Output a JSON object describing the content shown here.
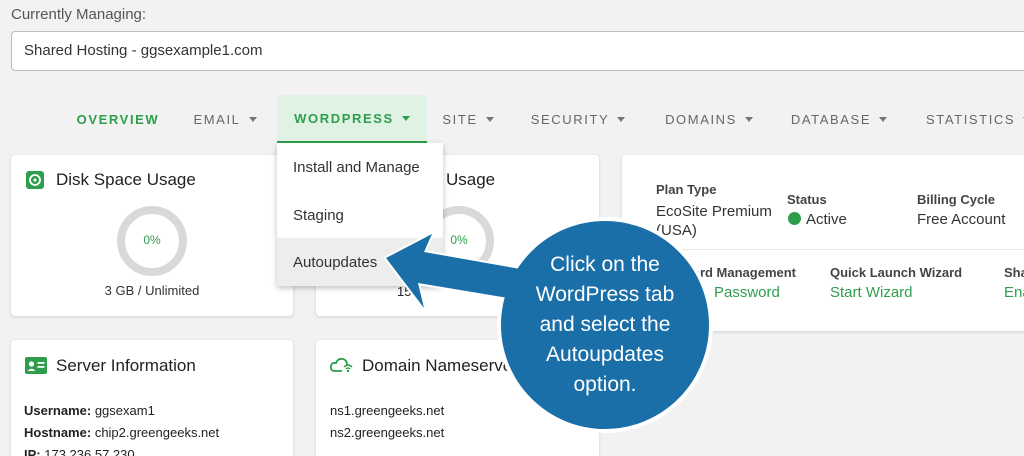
{
  "header": {
    "managing_label": "Currently Managing:",
    "selected_account": "Shared Hosting - ggsexample1.com"
  },
  "nav": {
    "tabs": [
      {
        "label": "OVERVIEW",
        "has_caret": false
      },
      {
        "label": "EMAIL",
        "has_caret": true
      },
      {
        "label": "WORDPRESS",
        "has_caret": true,
        "active": true
      },
      {
        "label": "SITE",
        "has_caret": true
      },
      {
        "label": "SECURITY",
        "has_caret": true
      },
      {
        "label": "DOMAINS",
        "has_caret": true
      },
      {
        "label": "DATABASE",
        "has_caret": true
      },
      {
        "label": "STATISTICS",
        "has_caret": true
      }
    ]
  },
  "wordpress_menu": {
    "items": [
      "Install and Manage",
      "Staging",
      "Autoupdates"
    ],
    "hovered_item": "Autoupdates"
  },
  "disk_card": {
    "title": "Disk Space Usage",
    "percent_label": "0%",
    "usage": "3 GB / Unlimited",
    "icon": "disk-icon"
  },
  "second_usage_card": {
    "title_partial": "Usage",
    "percent_label": "0%",
    "value_partial": "15"
  },
  "plan_card": {
    "plan_type_label": "Plan Type",
    "plan_type_value": "EcoSite Premium (USA)",
    "status_label": "Status",
    "status_value": "Active",
    "billing_label": "Billing Cycle",
    "billing_value": "Free Account",
    "password_mgmt_label": "ord Management",
    "password_link": "Password",
    "quick_launch_label": "Quick Launch Wizard",
    "quick_launch_link": "Start Wizard",
    "share_label": "Sha",
    "share_link": "Ena"
  },
  "server_card": {
    "title": "Server Information",
    "rows": [
      {
        "label": "Username:",
        "value": "ggsexam1"
      },
      {
        "label": "Hostname:",
        "value": "chip2.greengeeks.net"
      },
      {
        "label": "IP:",
        "value": "173.236.57.230"
      }
    ],
    "icon": "id-card-icon"
  },
  "nameserver_card": {
    "title": "Domain Nameserve",
    "servers": [
      "ns1.greengeeks.net",
      "ns2.greengeeks.net"
    ],
    "icon": "cloud-wifi-icon"
  },
  "callout": {
    "text": "Click on the WordPress tab and select the Autoupdates option.",
    "lines": [
      "Click on the",
      "WordPress tab",
      "and select the",
      "Autoupdates",
      "option."
    ]
  },
  "colors": {
    "accent_green": "#2e9e4d",
    "active_tab_bg": "#dff2e4",
    "callout_blue": "#1a6fa8"
  }
}
